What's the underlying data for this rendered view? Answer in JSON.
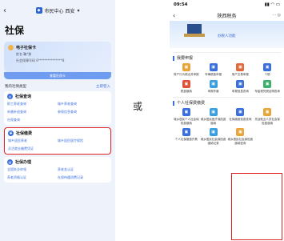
{
  "left": {
    "header_title": "市民中心 西安",
    "page_title": "社保",
    "card": {
      "title": "电子社保卡",
      "name_line": "姓名  鞠*勇",
      "id_line": "社会保障号码  6***************8",
      "button": "查看社保卡"
    },
    "my_types": {
      "label": "我的社保类型",
      "more": "立即登入"
    },
    "sections": [
      {
        "title": "社保查询",
        "items": [
          "职工养老查询",
          "城乡养老查询",
          "补缴补退查询",
          "参保信息查询",
          "社保查询"
        ]
      },
      {
        "title": "社保缴费",
        "items": [
          "城乡居民养老",
          "城乡居民医疗保险",
          "灵活就业缴费凭证"
        ]
      },
      {
        "title": "社保办理",
        "items": [
          "全国失业申领",
          "养老金认证",
          "养老资格认证",
          "社保待遇消费记录"
        ]
      }
    ]
  },
  "separator": "或",
  "right": {
    "status_time": "09:54",
    "nav_title": "陕西税务",
    "nav_actions": "···  ◎",
    "slogan": "办税人功能",
    "sections": [
      {
        "title": "我要申报",
        "items": [
          {
            "label": "财产行为税合并申报",
            "color": "#e8a63a",
            "icon": "doc-icon"
          },
          {
            "label": "车辆税费申报",
            "color": "#3a6fdc",
            "icon": "car-icon"
          },
          {
            "label": "房产交易申报",
            "color": "#e06a3a",
            "icon": "house-icon"
          },
          {
            "label": "个税",
            "color": "#3a6fdc",
            "icon": "ticket-icon"
          },
          {
            "label": "税费缴纳",
            "color": "#e0533a",
            "icon": "tax-icon"
          },
          {
            "label": "申报作废",
            "color": "#3a9fdc",
            "icon": "void-icon"
          },
          {
            "label": "申报信息查询",
            "color": "#3a6fdc",
            "icon": "query-icon"
          },
          {
            "label": "车船税完税证明查询",
            "color": "#3ab06a",
            "icon": "cert-icon"
          }
        ]
      },
      {
        "title": "个人社保费缴费",
        "items": [
          {
            "label": "城乡居民个人社会保险费缴纳",
            "color": "#3a6fdc",
            "icon": "pay-icon"
          },
          {
            "label": "城乡居民医疗保险费缴纳",
            "color": "#3a9fdc",
            "icon": "medical-icon"
          },
          {
            "label": "社保缴费信息查询",
            "color": "#3a6fdc",
            "icon": "info-icon"
          },
          {
            "label": "灵活就业人员社会保险费缴纳",
            "color": "#e8a63a",
            "icon": "flex-icon"
          },
          {
            "label": "个人社保缴费开具",
            "color": "#3a6fdc",
            "icon": "invoice-icon"
          },
          {
            "label": "城乡居民社会保险费缴纳记录",
            "color": "#3a9fdc",
            "icon": "record-icon"
          },
          {
            "label": "城乡居民社会保险费缴纳查询",
            "color": "#e8a63a",
            "icon": "search-icon"
          }
        ]
      }
    ]
  }
}
